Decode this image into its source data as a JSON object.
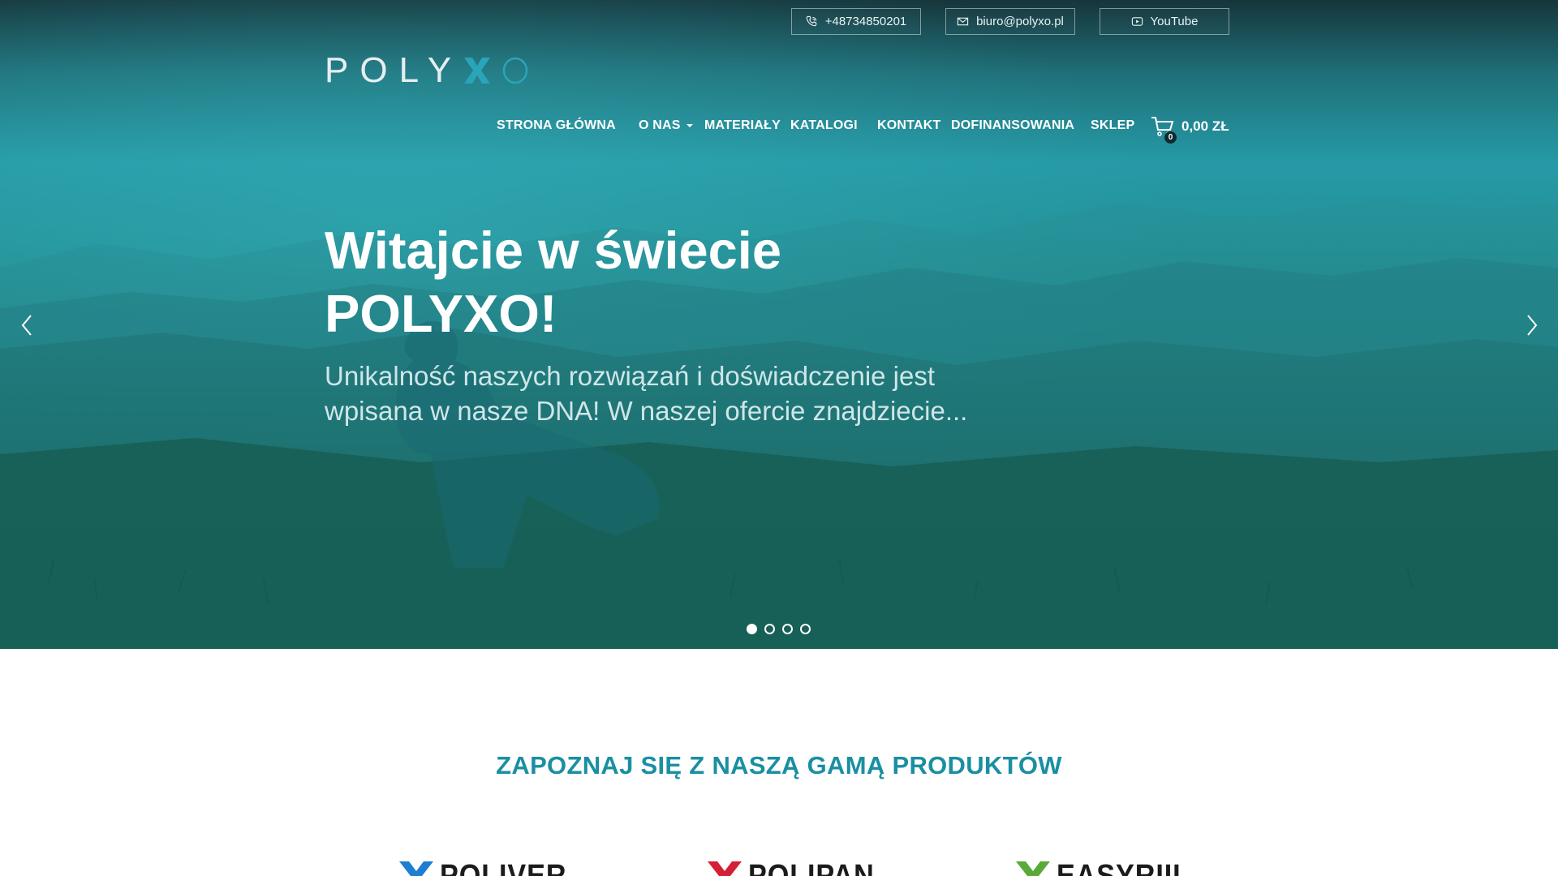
{
  "topbar": {
    "phone": "+48734850201",
    "email": "biuro@polyxo.pl",
    "youtube": "YouTube"
  },
  "logo": {
    "text_left": "POLY",
    "text_x": "X",
    "text_right": "O",
    "accent_color": "#2aa4b8"
  },
  "nav": {
    "items": [
      {
        "label": "STRONA GŁÓWNA"
      },
      {
        "label": "O NAS"
      },
      {
        "label": "MATERIAŁY"
      },
      {
        "label": "KATALOGI"
      },
      {
        "label": "KONTAKT"
      },
      {
        "label": "DOFINANSOWANIA"
      },
      {
        "label": "SKLEP"
      }
    ],
    "cart_count": "0",
    "cart_total": "0,00 ZŁ"
  },
  "hero": {
    "title_line1": "Witajcie w świecie",
    "title_line2": "POLYXO!",
    "subtitle_line1": "Unikalność naszych rozwiązań i doświadczenie jest",
    "subtitle_line2": "wpisana w nasze DNA! W naszej ofercie znajdziecie...",
    "slides_total": 4,
    "active_slide": 1
  },
  "products": {
    "heading": "ZAPOZNAJ SIĘ Z NASZĄ GAMĄ PRODUKTÓW",
    "brands": [
      {
        "name": "POLIVER",
        "color": "#1e7fd0"
      },
      {
        "name": "POLIPAN",
        "color": "#d51f36"
      },
      {
        "name": "EASYRIII",
        "color": "#5aaa3a"
      }
    ]
  },
  "colors": {
    "heading": "#1a8fa2",
    "hero_overlay": "#1f8d96"
  }
}
